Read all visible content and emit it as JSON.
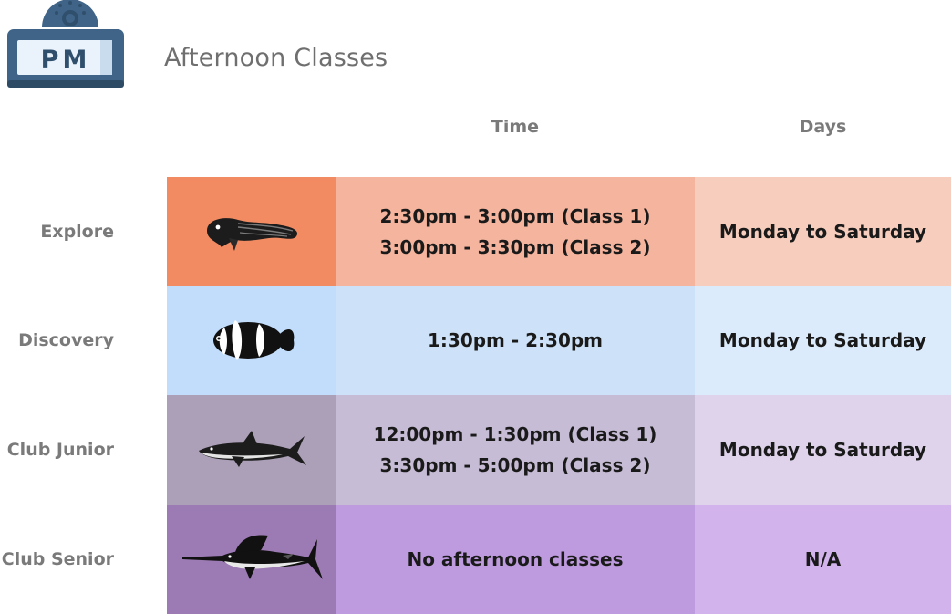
{
  "badge": {
    "label": "PM"
  },
  "title": "Afternoon Classes",
  "columns": {
    "time": "Time",
    "days": "Days"
  },
  "colors": {
    "explore": [
      "#f28b62",
      "#f5b49d",
      "#f7cebd"
    ],
    "discovery": [
      "#c2ddfb",
      "#cde2f8",
      "#dcebfb"
    ],
    "club_junior": [
      "#aca0b8",
      "#c7bcd5",
      "#ded3ea"
    ],
    "club_senior": [
      "#9c7ab3",
      "#be9adf",
      "#d2b3ec"
    ]
  },
  "rows": [
    {
      "name": "Explore",
      "icon": "eel-icon",
      "times": [
        "2:30pm - 3:00pm (Class 1)",
        "3:00pm - 3:30pm (Class 2)"
      ],
      "days": "Monday to Saturday"
    },
    {
      "name": "Discovery",
      "icon": "clownfish-icon",
      "times": [
        "1:30pm - 2:30pm"
      ],
      "days": "Monday to Saturday"
    },
    {
      "name": "Club Junior",
      "icon": "shark-icon",
      "times": [
        "12:00pm - 1:30pm (Class 1)",
        "3:30pm - 5:00pm (Class 2)"
      ],
      "days": "Monday to Saturday"
    },
    {
      "name": "Club Senior",
      "icon": "swordfish-icon",
      "times": [
        "No afternoon classes"
      ],
      "days": "N/A"
    }
  ]
}
